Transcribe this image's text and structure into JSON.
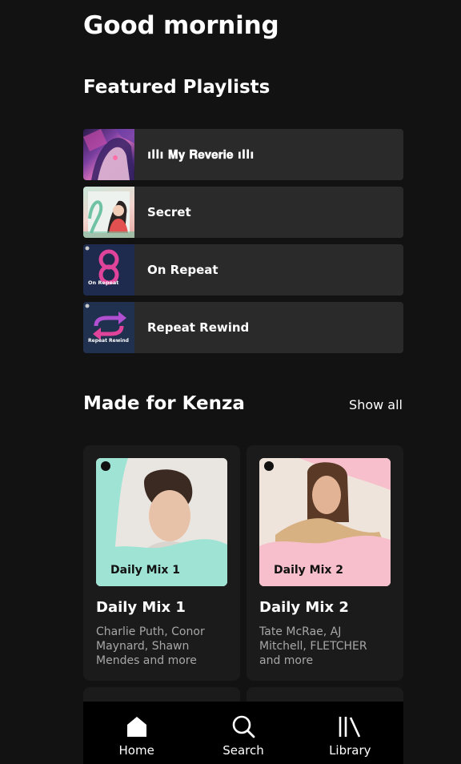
{
  "greeting": "Good morning",
  "featured": {
    "title": "Featured Playlists",
    "items": [
      {
        "label": "ıllı 𝐌𝐲 𝐑𝐞𝐯𝐞𝐫𝐢𝐞 ıllı",
        "icon": "anime-art-thumbnail"
      },
      {
        "label": "Secret",
        "icon": "portrait-thumbnail"
      },
      {
        "label": "On Repeat",
        "icon": "on-repeat-thumbnail",
        "cover_text": "On Repeat"
      },
      {
        "label": "Repeat Rewind",
        "icon": "repeat-rewind-thumbnail",
        "cover_text": "Repeat Rewind"
      }
    ]
  },
  "made_for": {
    "title": "Made for Kenza",
    "show_all": "Show all",
    "cards": [
      {
        "title": "Daily Mix 1",
        "cover_label": "Daily Mix 1",
        "subtitle": "Charlie Puth, Conor Maynard, Shawn Mendes and more",
        "accent": "#9fe3d5"
      },
      {
        "title": "Daily Mix 2",
        "cover_label": "Daily Mix 2",
        "subtitle": "Tate McRae, AJ Mitchell, FLETCHER and more",
        "accent": "#f6bfcb"
      }
    ]
  },
  "nav": {
    "items": [
      {
        "label": "Home",
        "icon": "home-icon"
      },
      {
        "label": "Search",
        "icon": "search-icon"
      },
      {
        "label": "Library",
        "icon": "library-icon"
      }
    ]
  },
  "colors": {
    "background": "#121212",
    "row": "#2a2a2a",
    "card": "#1b1b1b",
    "muted_text": "#a7a7a7",
    "nav_background": "#000000"
  }
}
